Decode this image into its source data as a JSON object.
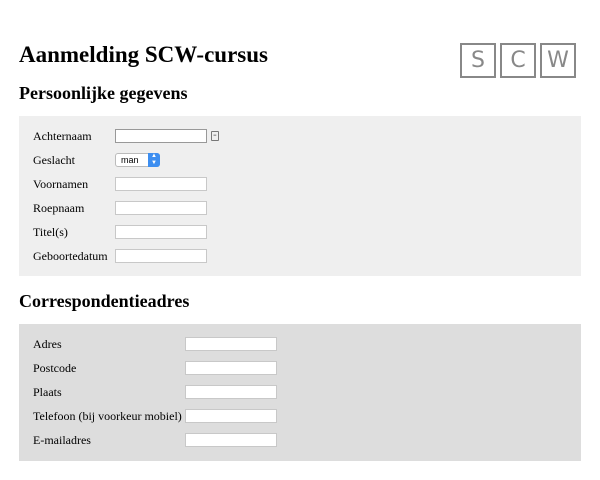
{
  "title": "Aanmelding SCW-cursus",
  "logo": [
    "S",
    "C",
    "W"
  ],
  "personal": {
    "title": "Persoonlijke gegevens",
    "fields": [
      {
        "label": "Achternaam",
        "value": ""
      },
      {
        "label": "Geslacht",
        "value": "man"
      },
      {
        "label": "Voornamen",
        "value": ""
      },
      {
        "label": "Roepnaam",
        "value": ""
      },
      {
        "label": "Titel(s)",
        "value": ""
      },
      {
        "label": "Geboortedatum",
        "value": ""
      }
    ],
    "gender_options": [
      "man"
    ]
  },
  "address": {
    "title": "Correspondentieadres",
    "fields": [
      {
        "label": "Adres",
        "value": ""
      },
      {
        "label": "Postcode",
        "value": ""
      },
      {
        "label": "Plaats",
        "value": ""
      },
      {
        "label": "Telefoon (bij voorkeur mobiel)",
        "value": ""
      },
      {
        "label": "E-mailadres",
        "value": ""
      }
    ]
  },
  "colors": {
    "panel_personal": "#efefef",
    "panel_address": "#dddddd",
    "select_accent": "#3d8ef0"
  }
}
